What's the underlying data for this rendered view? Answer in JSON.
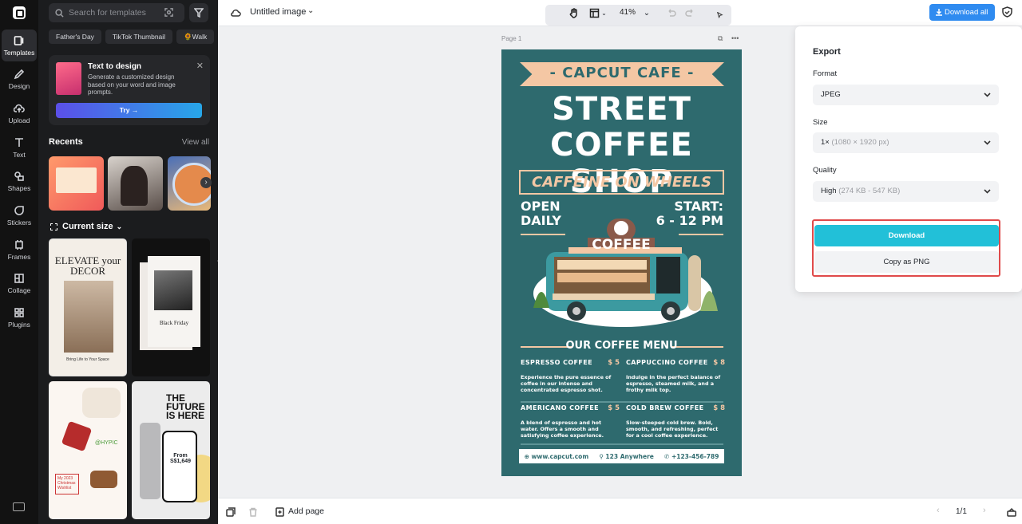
{
  "rail": {
    "items": [
      {
        "label": "Templates",
        "icon": "templates-icon"
      },
      {
        "label": "Design",
        "icon": "design-icon"
      },
      {
        "label": "Upload",
        "icon": "upload-icon"
      },
      {
        "label": "Text",
        "icon": "text-icon"
      },
      {
        "label": "Shapes",
        "icon": "shapes-icon"
      },
      {
        "label": "Stickers",
        "icon": "stickers-icon"
      },
      {
        "label": "Frames",
        "icon": "frames-icon"
      },
      {
        "label": "Collage",
        "icon": "collage-icon"
      },
      {
        "label": "Plugins",
        "icon": "plugins-icon"
      }
    ]
  },
  "panel": {
    "search_placeholder": "Search for templates",
    "chips": [
      "Father's Day",
      "TikTok Thumbnail",
      "🌻Walk"
    ],
    "text_to_design": {
      "title": "Text to design",
      "description": "Generate a customized design based on your word and image prompts.",
      "button": "Try →"
    },
    "recents_title": "Recents",
    "view_all": "View all",
    "current_size": "Current size",
    "templates": {
      "t1_title": "ELEVATE your DECOR",
      "t1_footer": "Bring Life to Your Space",
      "t2_text": "Black Friday",
      "t3_tag": "@HYPIC",
      "t3_wishlist": "My 2023 Christmas Wishlist",
      "t4_title": "THE FUTURE IS HERE",
      "t4_price": "From S$1,649"
    }
  },
  "topbar": {
    "title": "Untitled image",
    "zoom": "41%",
    "download_all": "Download all"
  },
  "canvas": {
    "page_label": "Page 1",
    "poster": {
      "cafe": "- CAPCUT CAFE -",
      "line1": "STREET",
      "line2": "COFFEE SHOP",
      "tagline": "CAFFEINE ON WHEELS",
      "open": "OPEN\nDAILY",
      "start": "START:\n6 - 12 PM",
      "truck_sign": "COFFEE",
      "menu_title": "OUR COFFEE MENU",
      "items": [
        {
          "name": "ESPRESSO COFFEE",
          "price": "$ 5",
          "desc": "Experience the pure essence of coffee in our intense and concentrated espresso shot."
        },
        {
          "name": "CAPPUCCINO COFFEE",
          "price": "$ 8",
          "desc": "Indulge in the perfect balance of espresso, steamed milk, and a frothy milk top."
        },
        {
          "name": "AMERICANO COFFEE",
          "price": "$ 5",
          "desc": "A blend of espresso and hot water. Offers a smooth and satisfying coffee experience."
        },
        {
          "name": "COLD BREW COFFEE",
          "price": "$ 8",
          "desc": "Slow-steeped cold brew. Bold, smooth, and refreshing, perfect for a cool coffee experience."
        }
      ],
      "website": "www.capcut.com",
      "address": "123 Anywhere",
      "phone": "+123-456-789"
    }
  },
  "export": {
    "title": "Export",
    "format_label": "Format",
    "format_value": "JPEG",
    "size_label": "Size",
    "size_value": "1×",
    "size_detail": "(1080 × 1920 px)",
    "quality_label": "Quality",
    "quality_value": "High",
    "quality_detail": "(274 KB - 547 KB)",
    "download": "Download",
    "copy_png": "Copy as PNG"
  },
  "bottombar": {
    "add_page": "Add page",
    "page_count": "1/1"
  },
  "colors": {
    "accent": "#22c0d8",
    "download_all": "#2f8bf0",
    "poster_bg": "#2e6a6e",
    "poster_peach": "#f4c7a4",
    "highlight": "#e04a4a"
  }
}
